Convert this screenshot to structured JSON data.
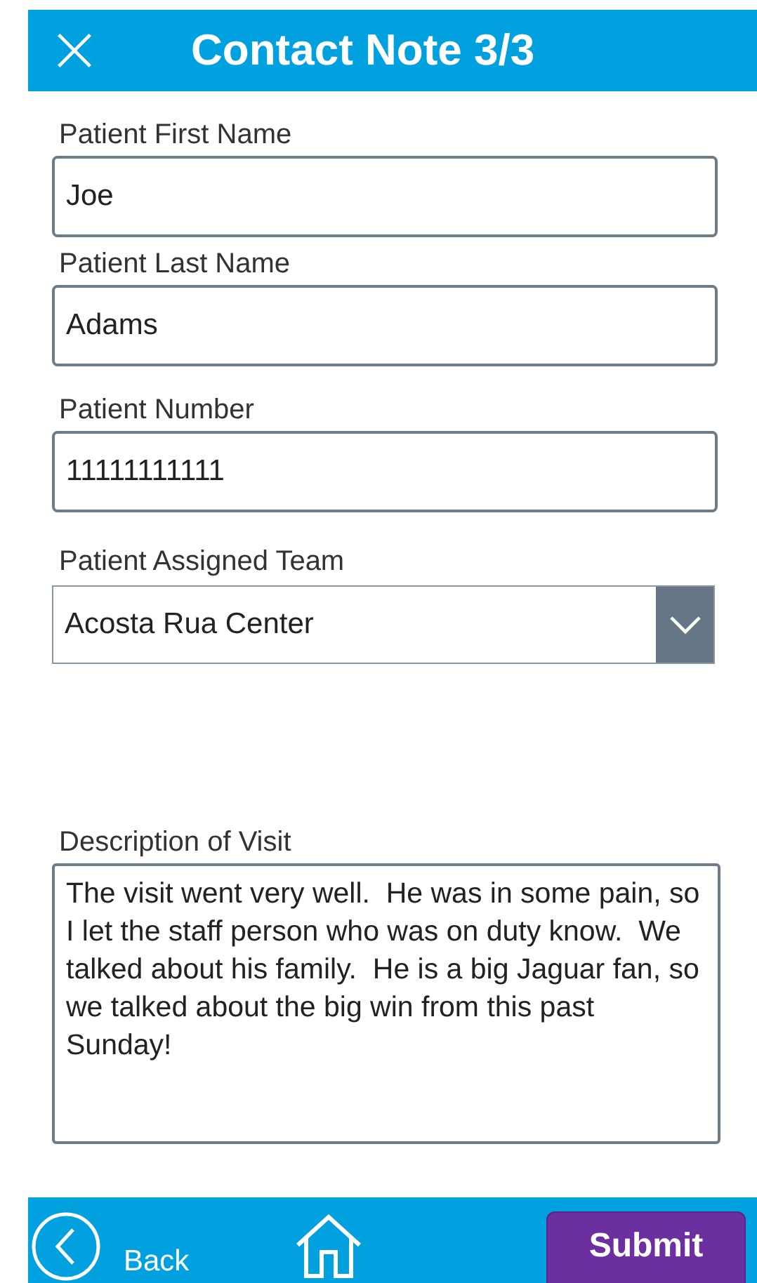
{
  "header": {
    "title": "Contact Note 3/3"
  },
  "fields": [
    {
      "kind": "text",
      "label": "Patient First Name",
      "value": "Joe"
    },
    {
      "kind": "text",
      "label": "Patient Last Name",
      "value": "Adams"
    },
    {
      "kind": "text",
      "label": "Patient Number",
      "value": "11111111111"
    },
    {
      "kind": "select",
      "label": "Patient Assigned Team",
      "value": "Acosta Rua Center"
    },
    {
      "kind": "textarea",
      "label": "Description of Visit",
      "value": "The visit went very well.  He was in some pain, so I let the staff person who was on duty know.  We talked about his family.  He is a big Jaguar fan, so we talked about the big win from this past Sunday!"
    }
  ],
  "footer": {
    "back_label": "Back",
    "submit_label": "Submit"
  }
}
